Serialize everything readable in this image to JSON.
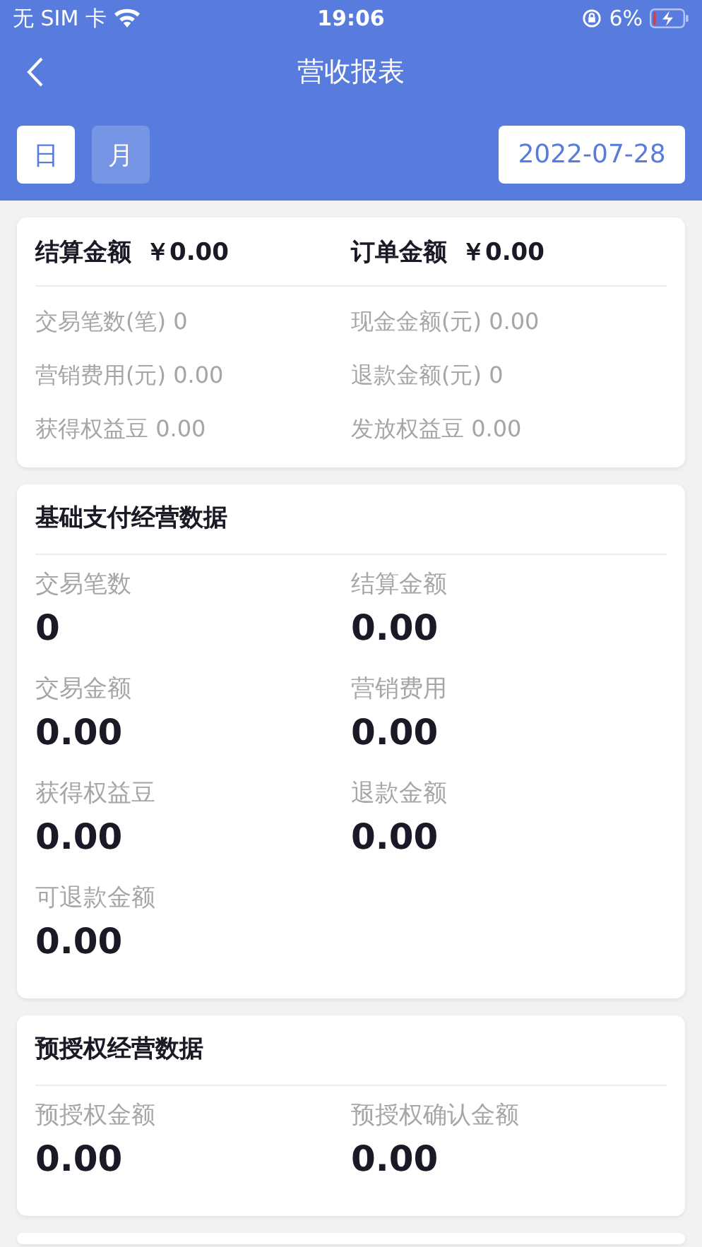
{
  "status_bar": {
    "carrier": "无 SIM 卡",
    "time": "19:06",
    "battery": "6%"
  },
  "nav": {
    "title": "营收报表"
  },
  "period_tabs": [
    {
      "label": "日",
      "selected": true
    },
    {
      "label": "月",
      "selected": false
    }
  ],
  "date": "2022-07-28",
  "summary": {
    "totals": [
      {
        "label": "结算金额",
        "value": "￥0.00"
      },
      {
        "label": "订单金额",
        "value": "￥0.00"
      }
    ],
    "stats": [
      "交易笔数(笔) 0",
      "现金金额(元) 0.00",
      "营销费用(元) 0.00",
      "退款金额(元) 0",
      "获得权益豆 0.00",
      "发放权益豆 0.00"
    ]
  },
  "sections": [
    {
      "title": "基础支付经营数据",
      "metrics": [
        {
          "label": "交易笔数",
          "value": "0"
        },
        {
          "label": "结算金额",
          "value": "0.00"
        },
        {
          "label": "交易金额",
          "value": "0.00"
        },
        {
          "label": "营销费用",
          "value": "0.00"
        },
        {
          "label": "获得权益豆",
          "value": "0.00"
        },
        {
          "label": "退款金额",
          "value": "0.00"
        },
        {
          "label": "可退款金额",
          "value": "0.00"
        }
      ]
    },
    {
      "title": "预授权经营数据",
      "metrics": [
        {
          "label": "预授权金额",
          "value": "0.00"
        },
        {
          "label": "预授权确认金额",
          "value": "0.00"
        }
      ]
    }
  ]
}
